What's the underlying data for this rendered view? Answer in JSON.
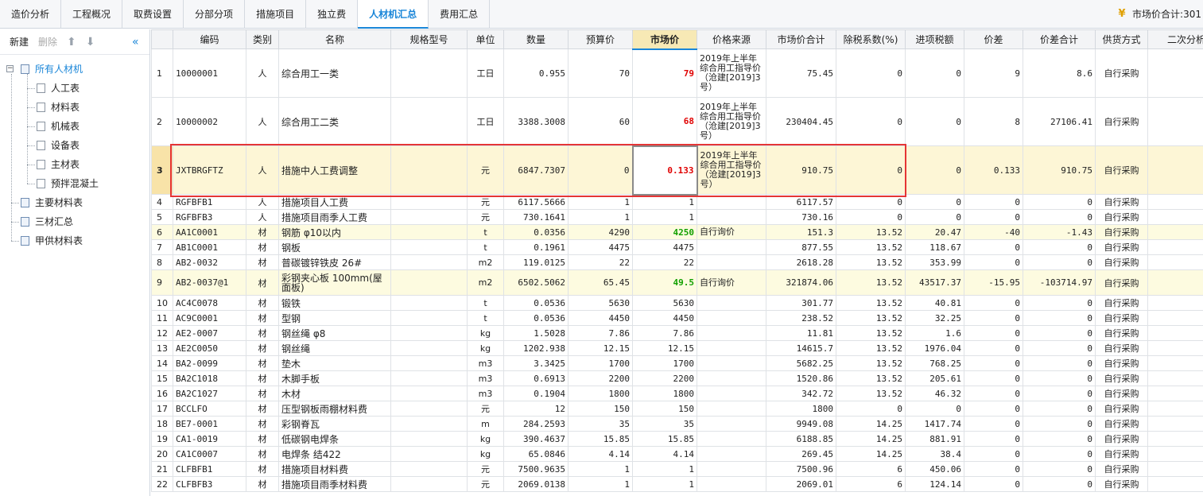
{
  "tabs": [
    {
      "label": "造价分析",
      "active": false
    },
    {
      "label": "工程概况",
      "active": false
    },
    {
      "label": "取费设置",
      "active": false
    },
    {
      "label": "分部分项",
      "active": false
    },
    {
      "label": "措施项目",
      "active": false
    },
    {
      "label": "独立费",
      "active": false
    },
    {
      "label": "人材机汇总",
      "active": true
    },
    {
      "label": "费用汇总",
      "active": false
    }
  ],
  "market_total_label": "市场价合计:301",
  "left_toolbar": {
    "new": "新建",
    "delete": "删除"
  },
  "tree": {
    "root": "所有人材机",
    "children": [
      "人工表",
      "材料表",
      "机械表",
      "设备表",
      "主材表",
      "预拌混凝土"
    ],
    "others": [
      "主要材料表",
      "三材汇总",
      "甲供材料表"
    ]
  },
  "columns": [
    "编码",
    "类别",
    "名称",
    "规格型号",
    "单位",
    "数量",
    "预算价",
    "市场价",
    "价格来源",
    "市场价合计",
    "除税系数(%)",
    "进项税额",
    "价差",
    "价差合计",
    "供货方式",
    "二次分析"
  ],
  "highlight_column": "市场价",
  "rows": [
    {
      "idx": "1",
      "code": "10000001",
      "cat": "人",
      "name": "综合用工一类",
      "spec": "",
      "unit": "工日",
      "qty": "0.955",
      "budget": "70",
      "market": "79",
      "market_style": "red",
      "source": "2019年上半年综合用工指导价（沧建[2019]3号）",
      "total": "75.45",
      "tax_rate": "0",
      "tax": "0",
      "diff": "9",
      "diff_total": "8.6",
      "supply": "自行采购",
      "rowtype": "tall"
    },
    {
      "idx": "2",
      "code": "10000002",
      "cat": "人",
      "name": "综合用工二类",
      "spec": "",
      "unit": "工日",
      "qty": "3388.3008",
      "budget": "60",
      "market": "68",
      "market_style": "red",
      "source": "2019年上半年综合用工指导价（沧建[2019]3号）",
      "total": "230404.45",
      "tax_rate": "0",
      "tax": "0",
      "diff": "8",
      "diff_total": "27106.41",
      "supply": "自行采购",
      "rowtype": "tall"
    },
    {
      "idx": "3",
      "code": "JXTBRGFTZ",
      "cat": "人",
      "name": "措施中人工费调整",
      "spec": "",
      "unit": "元",
      "qty": "6847.7307",
      "budget": "0",
      "market": "0.133",
      "market_style": "red",
      "source": "2019年上半年综合用工指导价（沧建[2019]3号）",
      "total": "910.75",
      "tax_rate": "0",
      "tax": "0",
      "diff": "0.133",
      "diff_total": "910.75",
      "supply": "自行采购",
      "rowtype": "tall selected"
    },
    {
      "idx": "4",
      "code": "RGFBFB1",
      "cat": "人",
      "name": "措施项目人工费",
      "spec": "",
      "unit": "元",
      "qty": "6117.5666",
      "budget": "1",
      "market": "1",
      "market_style": "",
      "source": "",
      "total": "6117.57",
      "tax_rate": "0",
      "tax": "0",
      "diff": "0",
      "diff_total": "0",
      "supply": "自行采购",
      "rowtype": ""
    },
    {
      "idx": "5",
      "code": "RGFBFB3",
      "cat": "人",
      "name": "措施项目雨季人工费",
      "spec": "",
      "unit": "元",
      "qty": "730.1641",
      "budget": "1",
      "market": "1",
      "market_style": "",
      "source": "",
      "total": "730.16",
      "tax_rate": "0",
      "tax": "0",
      "diff": "0",
      "diff_total": "0",
      "supply": "自行采购",
      "rowtype": ""
    },
    {
      "idx": "6",
      "code": "AA1C0001",
      "cat": "材",
      "name": "钢筋 φ10以内",
      "spec": "",
      "unit": "t",
      "qty": "0.0356",
      "budget": "4290",
      "market": "4250",
      "market_style": "green",
      "source": "自行询价",
      "total": "151.3",
      "tax_rate": "13.52",
      "tax": "20.47",
      "diff": "-40",
      "diff_total": "-1.43",
      "supply": "自行采购",
      "rowtype": "yellow"
    },
    {
      "idx": "7",
      "code": "AB1C0001",
      "cat": "材",
      "name": "钢板",
      "spec": "",
      "unit": "t",
      "qty": "0.1961",
      "budget": "4475",
      "market": "4475",
      "market_style": "",
      "source": "",
      "total": "877.55",
      "tax_rate": "13.52",
      "tax": "118.67",
      "diff": "0",
      "diff_total": "0",
      "supply": "自行采购",
      "rowtype": ""
    },
    {
      "idx": "8",
      "code": "AB2-0032",
      "cat": "材",
      "name": "普碳镀锌铁皮 26#",
      "spec": "",
      "unit": "m2",
      "qty": "119.0125",
      "budget": "22",
      "market": "22",
      "market_style": "",
      "source": "",
      "total": "2618.28",
      "tax_rate": "13.52",
      "tax": "353.99",
      "diff": "0",
      "diff_total": "0",
      "supply": "自行采购",
      "rowtype": ""
    },
    {
      "idx": "9",
      "code": "AB2-0037@1",
      "cat": "材",
      "name": "彩钢夹心板 100mm(屋面板)",
      "spec": "",
      "unit": "m2",
      "qty": "6502.5062",
      "budget": "65.45",
      "market": "49.5",
      "market_style": "green",
      "source": "自行询价",
      "total": "321874.06",
      "tax_rate": "13.52",
      "tax": "43517.37",
      "diff": "-15.95",
      "diff_total": "-103714.97",
      "supply": "自行采购",
      "rowtype": "med yellow"
    },
    {
      "idx": "10",
      "code": "AC4C0078",
      "cat": "材",
      "name": "锻铁",
      "spec": "",
      "unit": "t",
      "qty": "0.0536",
      "budget": "5630",
      "market": "5630",
      "market_style": "",
      "source": "",
      "total": "301.77",
      "tax_rate": "13.52",
      "tax": "40.81",
      "diff": "0",
      "diff_total": "0",
      "supply": "自行采购",
      "rowtype": ""
    },
    {
      "idx": "11",
      "code": "AC9C0001",
      "cat": "材",
      "name": "型钢",
      "spec": "",
      "unit": "t",
      "qty": "0.0536",
      "budget": "4450",
      "market": "4450",
      "market_style": "",
      "source": "",
      "total": "238.52",
      "tax_rate": "13.52",
      "tax": "32.25",
      "diff": "0",
      "diff_total": "0",
      "supply": "自行采购",
      "rowtype": ""
    },
    {
      "idx": "12",
      "code": "AE2-0007",
      "cat": "材",
      "name": "钢丝绳 φ8",
      "spec": "",
      "unit": "kg",
      "qty": "1.5028",
      "budget": "7.86",
      "market": "7.86",
      "market_style": "",
      "source": "",
      "total": "11.81",
      "tax_rate": "13.52",
      "tax": "1.6",
      "diff": "0",
      "diff_total": "0",
      "supply": "自行采购",
      "rowtype": ""
    },
    {
      "idx": "13",
      "code": "AE2C0050",
      "cat": "材",
      "name": "钢丝绳",
      "spec": "",
      "unit": "kg",
      "qty": "1202.938",
      "budget": "12.15",
      "market": "12.15",
      "market_style": "",
      "source": "",
      "total": "14615.7",
      "tax_rate": "13.52",
      "tax": "1976.04",
      "diff": "0",
      "diff_total": "0",
      "supply": "自行采购",
      "rowtype": ""
    },
    {
      "idx": "14",
      "code": "BA2-0099",
      "cat": "材",
      "name": "垫木",
      "spec": "",
      "unit": "m3",
      "qty": "3.3425",
      "budget": "1700",
      "market": "1700",
      "market_style": "",
      "source": "",
      "total": "5682.25",
      "tax_rate": "13.52",
      "tax": "768.25",
      "diff": "0",
      "diff_total": "0",
      "supply": "自行采购",
      "rowtype": ""
    },
    {
      "idx": "15",
      "code": "BA2C1018",
      "cat": "材",
      "name": "木脚手板",
      "spec": "",
      "unit": "m3",
      "qty": "0.6913",
      "budget": "2200",
      "market": "2200",
      "market_style": "",
      "source": "",
      "total": "1520.86",
      "tax_rate": "13.52",
      "tax": "205.61",
      "diff": "0",
      "diff_total": "0",
      "supply": "自行采购",
      "rowtype": ""
    },
    {
      "idx": "16",
      "code": "BA2C1027",
      "cat": "材",
      "name": "木材",
      "spec": "",
      "unit": "m3",
      "qty": "0.1904",
      "budget": "1800",
      "market": "1800",
      "market_style": "",
      "source": "",
      "total": "342.72",
      "tax_rate": "13.52",
      "tax": "46.32",
      "diff": "0",
      "diff_total": "0",
      "supply": "自行采购",
      "rowtype": ""
    },
    {
      "idx": "17",
      "code": "BCCLFO",
      "cat": "材",
      "name": "压型钢板雨棚材料费",
      "spec": "",
      "unit": "元",
      "qty": "12",
      "budget": "150",
      "market": "150",
      "market_style": "",
      "source": "",
      "total": "1800",
      "tax_rate": "0",
      "tax": "0",
      "diff": "0",
      "diff_total": "0",
      "supply": "自行采购",
      "rowtype": ""
    },
    {
      "idx": "18",
      "code": "BE7-0001",
      "cat": "材",
      "name": "彩钢脊瓦",
      "spec": "",
      "unit": "m",
      "qty": "284.2593",
      "budget": "35",
      "market": "35",
      "market_style": "",
      "source": "",
      "total": "9949.08",
      "tax_rate": "14.25",
      "tax": "1417.74",
      "diff": "0",
      "diff_total": "0",
      "supply": "自行采购",
      "rowtype": ""
    },
    {
      "idx": "19",
      "code": "CA1-0019",
      "cat": "材",
      "name": "低碳钢电焊条",
      "spec": "",
      "unit": "kg",
      "qty": "390.4637",
      "budget": "15.85",
      "market": "15.85",
      "market_style": "",
      "source": "",
      "total": "6188.85",
      "tax_rate": "14.25",
      "tax": "881.91",
      "diff": "0",
      "diff_total": "0",
      "supply": "自行采购",
      "rowtype": ""
    },
    {
      "idx": "20",
      "code": "CA1C0007",
      "cat": "材",
      "name": "电焊条 结422",
      "spec": "",
      "unit": "kg",
      "qty": "65.0846",
      "budget": "4.14",
      "market": "4.14",
      "market_style": "",
      "source": "",
      "total": "269.45",
      "tax_rate": "14.25",
      "tax": "38.4",
      "diff": "0",
      "diff_total": "0",
      "supply": "自行采购",
      "rowtype": ""
    },
    {
      "idx": "21",
      "code": "CLFBFB1",
      "cat": "材",
      "name": "措施项目材料费",
      "spec": "",
      "unit": "元",
      "qty": "7500.9635",
      "budget": "1",
      "market": "1",
      "market_style": "",
      "source": "",
      "total": "7500.96",
      "tax_rate": "6",
      "tax": "450.06",
      "diff": "0",
      "diff_total": "0",
      "supply": "自行采购",
      "rowtype": ""
    },
    {
      "idx": "22",
      "code": "CLFBFB3",
      "cat": "材",
      "name": "措施项目雨季材料费",
      "spec": "",
      "unit": "元",
      "qty": "2069.0138",
      "budget": "1",
      "market": "1",
      "market_style": "",
      "source": "",
      "total": "2069.01",
      "tax_rate": "6",
      "tax": "124.14",
      "diff": "0",
      "diff_total": "0",
      "supply": "自行采购",
      "rowtype": ""
    }
  ],
  "colors": {
    "accent": "#1a86d8",
    "selection": "#e53535",
    "price_up": "#e00000",
    "price_down": "#12a000"
  }
}
